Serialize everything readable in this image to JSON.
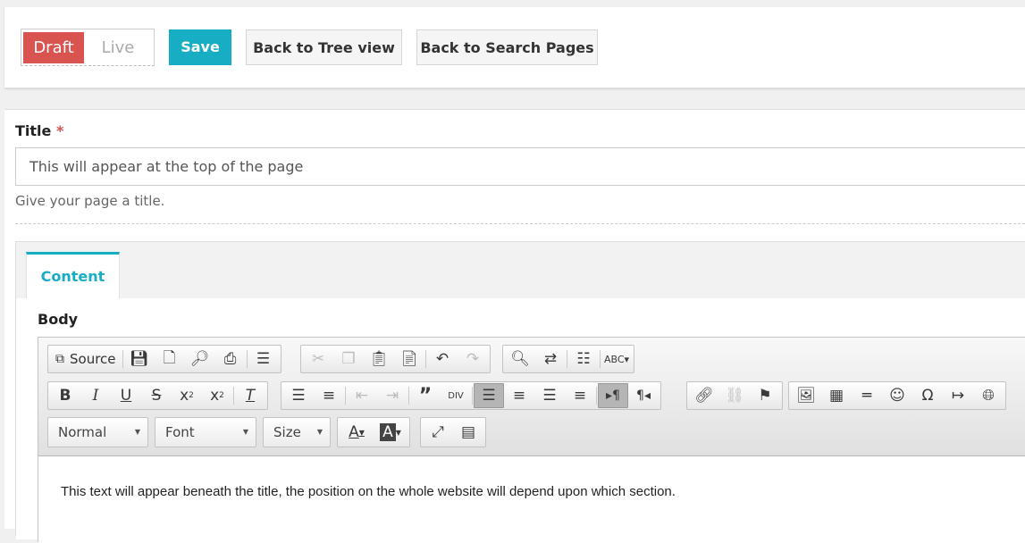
{
  "topbar": {
    "draft_label": "Draft",
    "live_label": "Live",
    "save_label": "Save",
    "tree_label": "Back to Tree view",
    "search_label": "Back to Search Pages"
  },
  "form": {
    "title_label": "Title",
    "required_mark": "*",
    "title_value": "This will appear at the top of the page",
    "title_help": "Give your page a title."
  },
  "tabs": [
    {
      "label": "Content",
      "active": true
    }
  ],
  "body_label": "Body",
  "editor": {
    "source_label": "Source",
    "format_combo": "Normal",
    "font_combo": "Font",
    "size_combo": "Size",
    "content": "This text will appear beneath the title, the position on the whole website will depend upon which section."
  },
  "colors": {
    "draft": "#d9534f",
    "accent": "#17aec4",
    "required": "#d9534f"
  }
}
